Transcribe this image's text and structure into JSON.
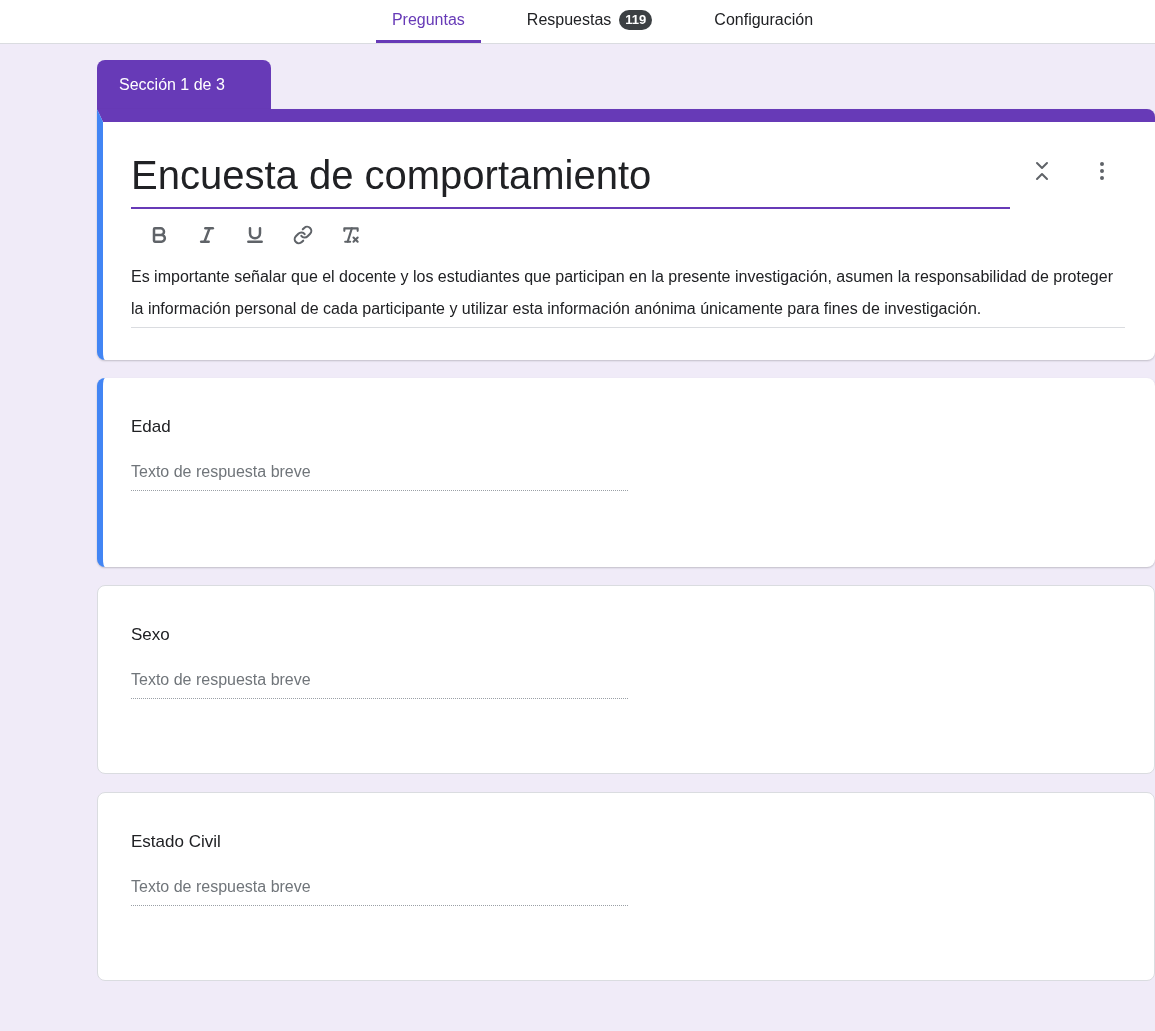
{
  "tabs": [
    {
      "label": "Preguntas",
      "selected": true
    },
    {
      "label": "Respuestas",
      "selected": false,
      "badge": "119"
    },
    {
      "label": "Configuración",
      "selected": false
    }
  ],
  "section_tab": "Sección 1 de 3",
  "header": {
    "title": "Encuesta de comportamiento",
    "selected": true,
    "description": "Es importante señalar que  el docente y los estudiantes que participan en la presente investigación, asumen la responsabilidad de proteger la información personal de cada participante y utilizar esta información anónima únicamente para fines de investigación."
  },
  "questions": [
    {
      "title": "Edad",
      "placeholder": "Texto de respuesta breve",
      "selected": true
    },
    {
      "title": "Sexo",
      "placeholder": "Texto de respuesta breve",
      "selected": false
    },
    {
      "title": "Estado Civil",
      "placeholder": "Texto de respuesta breve",
      "selected": false
    }
  ]
}
